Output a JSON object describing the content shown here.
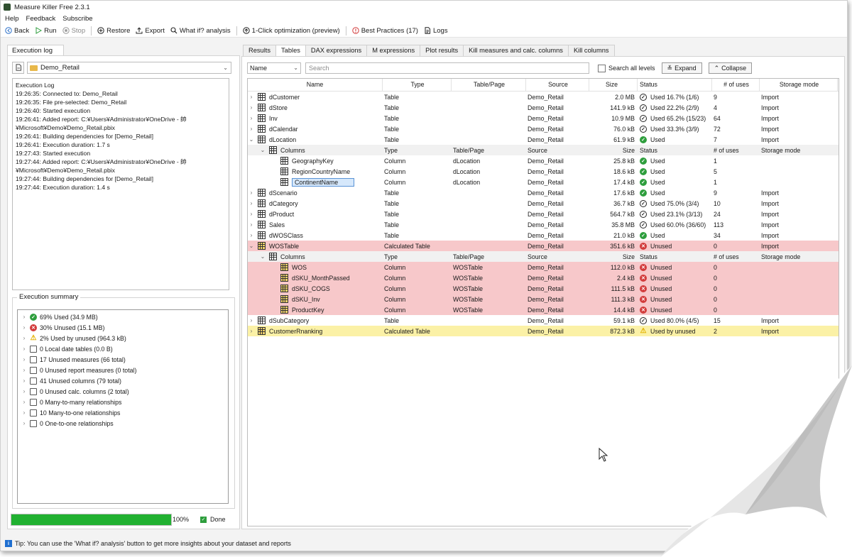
{
  "app": {
    "title": "Measure Killer Free 2.3.1"
  },
  "menu": [
    "Help",
    "Feedback",
    "Subscribe"
  ],
  "toolbar": {
    "back": "Back",
    "run": "Run",
    "stop": "Stop",
    "restore": "Restore",
    "export": "Export",
    "whatif": "What if? analysis",
    "optimize": "1-Click optimization (preview)",
    "best": "Best Practices (17)",
    "logs": "Logs"
  },
  "left": {
    "tab": "Execution log",
    "dataset": "Demo_Retail",
    "log_title": "Execution Log",
    "log_lines": [
      "19:26:35: Connected to: Demo_Retail",
      "19:26:35: File pre-selected: Demo_Retail",
      "19:26:40: Started execution",
      "19:26:41: Added report: C:¥Users¥Administrator¥OneDrive - 帥",
      "¥Microsoft¥Demo¥Demo_Retail.pbix",
      "19:26:41: Building dependencies for [Demo_Retail]",
      "19:26:41: Execution duration: 1.7 s",
      "19:27:43: Started execution",
      "19:27:44: Added report: C:¥Users¥Administrator¥OneDrive - 帥",
      "¥Microsoft¥Demo¥Demo_Retail.pbix",
      "19:27:44: Building dependencies for [Demo_Retail]",
      "19:27:44: Execution duration: 1.4 s"
    ],
    "summary_title": "Execution summary",
    "summary": [
      {
        "icon": "check-green",
        "text": "69% Used (34.9 MB)"
      },
      {
        "icon": "x-red",
        "text": "30% Unused (15.1 MB)"
      },
      {
        "icon": "warning",
        "text": "2% Used by unused (964.3 kB)"
      },
      {
        "icon": "calendar",
        "text": "0 Local date tables (0.0 B)"
      },
      {
        "icon": "calculator",
        "text": "17 Unused measures (66 total)"
      },
      {
        "icon": "calculator",
        "text": "0 Unused report measures (0 total)"
      },
      {
        "icon": "table",
        "text": "41 Unused columns (79 total)"
      },
      {
        "icon": "calc-column",
        "text": "0 Unused calc. columns (2 total)"
      },
      {
        "icon": "relationship",
        "text": "0 Many-to-many relationships"
      },
      {
        "icon": "relationship",
        "text": "10 Many-to-one relationships"
      },
      {
        "icon": "relationship",
        "text": "0 One-to-one relationships"
      }
    ],
    "progress_value": 100,
    "progress_label": "100%",
    "done_label": "Done"
  },
  "tabs": [
    "Results",
    "Tables",
    "DAX expressions",
    "M expressions",
    "Plot results",
    "Kill measures and calc. columns",
    "Kill columns"
  ],
  "active_tab": "Tables",
  "filter": {
    "field": "Name",
    "search_placeholder": "Search",
    "search_all": "Search all levels",
    "expand": "Expand",
    "collapse": "Collapse"
  },
  "columns": [
    "Name",
    "Type",
    "Table/Page",
    "Source",
    "Size",
    "Status",
    "# of uses",
    "Storage mode"
  ],
  "rows": [
    {
      "kind": "table",
      "expand": ">",
      "name": "dCustomer",
      "type": "Table",
      "tp": "",
      "src": "Demo_Retail",
      "size": "2.0 MB",
      "st": "partial",
      "status": "Used 16.7% (1/6)",
      "uses": "9",
      "stor": "Import"
    },
    {
      "kind": "table",
      "expand": ">",
      "name": "dStore",
      "type": "Table",
      "tp": "",
      "src": "Demo_Retail",
      "size": "141.9 kB",
      "st": "partial",
      "status": "Used 22.2% (2/9)",
      "uses": "4",
      "stor": "Import"
    },
    {
      "kind": "table",
      "expand": ">",
      "name": "Inv",
      "type": "Table",
      "tp": "",
      "src": "Demo_Retail",
      "size": "10.9 MB",
      "st": "partial",
      "status": "Used 65.2% (15/23)",
      "uses": "64",
      "stor": "Import"
    },
    {
      "kind": "table",
      "expand": ">",
      "name": "dCalendar",
      "type": "Table",
      "tp": "",
      "src": "Demo_Retail",
      "size": "76.0 kB",
      "st": "partial",
      "status": "Used 33.3% (3/9)",
      "uses": "72",
      "stor": "Import"
    },
    {
      "kind": "table",
      "expand": "v",
      "name": "dLocation",
      "type": "Table",
      "tp": "",
      "src": "Demo_Retail",
      "size": "61.9 kB",
      "st": "used",
      "status": "Used",
      "uses": "7",
      "stor": "Import"
    },
    {
      "kind": "subhdr",
      "name": "Columns",
      "type": "Type",
      "tp": "Table/Page",
      "src": "Source",
      "size": "Size",
      "status": "Status",
      "uses": "# of uses",
      "stor": "Storage mode"
    },
    {
      "kind": "col",
      "name": "GeographyKey",
      "type": "Column",
      "tp": "dLocation",
      "src": "Demo_Retail",
      "size": "25.8 kB",
      "st": "used",
      "status": "Used",
      "uses": "1",
      "stor": ""
    },
    {
      "kind": "col",
      "name": "RegionCountryName",
      "type": "Column",
      "tp": "dLocation",
      "src": "Demo_Retail",
      "size": "18.6 kB",
      "st": "used",
      "status": "Used",
      "uses": "5",
      "stor": ""
    },
    {
      "kind": "col",
      "sel": true,
      "name": "ContinentName",
      "type": "Column",
      "tp": "dLocation",
      "src": "Demo_Retail",
      "size": "17.4 kB",
      "st": "used",
      "status": "Used",
      "uses": "1",
      "stor": ""
    },
    {
      "kind": "table",
      "expand": ">",
      "name": "dScenario",
      "type": "Table",
      "tp": "",
      "src": "Demo_Retail",
      "size": "17.6 kB",
      "st": "used",
      "status": "Used",
      "uses": "9",
      "stor": "Import"
    },
    {
      "kind": "table",
      "expand": ">",
      "name": "dCategory",
      "type": "Table",
      "tp": "",
      "src": "Demo_Retail",
      "size": "36.7 kB",
      "st": "partial",
      "status": "Used 75.0% (3/4)",
      "uses": "10",
      "stor": "Import"
    },
    {
      "kind": "table",
      "expand": ">",
      "name": "dProduct",
      "type": "Table",
      "tp": "",
      "src": "Demo_Retail",
      "size": "564.7 kB",
      "st": "partial",
      "status": "Used 23.1% (3/13)",
      "uses": "24",
      "stor": "Import"
    },
    {
      "kind": "table",
      "expand": ">",
      "name": "Sales",
      "type": "Table",
      "tp": "",
      "src": "Demo_Retail",
      "size": "35.8 MB",
      "st": "partial",
      "status": "Used 60.0% (36/60)",
      "uses": "113",
      "stor": "Import"
    },
    {
      "kind": "table",
      "expand": ">",
      "name": "dWOSClass",
      "type": "Table",
      "tp": "",
      "src": "Demo_Retail",
      "size": "21.0 kB",
      "st": "used",
      "status": "Used",
      "uses": "34",
      "stor": "Import"
    },
    {
      "kind": "calc",
      "row": "red",
      "expand": "v",
      "name": "WOSTable",
      "type": "Calculated Table",
      "tp": "",
      "src": "Demo_Retail",
      "size": "351.6 kB",
      "st": "unused",
      "status": "Unused",
      "uses": "0",
      "stor": "Import"
    },
    {
      "kind": "subhdr",
      "name": "Columns",
      "type": "Type",
      "tp": "Table/Page",
      "src": "Source",
      "size": "Size",
      "status": "Status",
      "uses": "# of uses",
      "stor": "Storage mode"
    },
    {
      "kind": "ccol",
      "row": "red",
      "name": "WOS",
      "type": "Column",
      "tp": "WOSTable",
      "src": "Demo_Retail",
      "size": "112.0 kB",
      "st": "unused",
      "status": "Unused",
      "uses": "0",
      "stor": ""
    },
    {
      "kind": "ccol",
      "row": "red",
      "name": "dSKU_MonthPassed",
      "type": "Column",
      "tp": "WOSTable",
      "src": "Demo_Retail",
      "size": "2.4 kB",
      "st": "unused",
      "status": "Unused",
      "uses": "0",
      "stor": ""
    },
    {
      "kind": "ccol",
      "row": "red",
      "name": "dSKU_COGS",
      "type": "Column",
      "tp": "WOSTable",
      "src": "Demo_Retail",
      "size": "111.5 kB",
      "st": "unused",
      "status": "Unused",
      "uses": "0",
      "stor": ""
    },
    {
      "kind": "ccol",
      "row": "red",
      "name": "dSKU_Inv",
      "type": "Column",
      "tp": "WOSTable",
      "src": "Demo_Retail",
      "size": "111.3 kB",
      "st": "unused",
      "status": "Unused",
      "uses": "0",
      "stor": ""
    },
    {
      "kind": "ccol",
      "row": "red",
      "name": "ProductKey",
      "type": "Column",
      "tp": "WOSTable",
      "src": "Demo_Retail",
      "size": "14.4 kB",
      "st": "unused",
      "status": "Unused",
      "uses": "0",
      "stor": ""
    },
    {
      "kind": "table",
      "expand": ">",
      "name": "dSubCategory",
      "type": "Table",
      "tp": "",
      "src": "Demo_Retail",
      "size": "59.1 kB",
      "st": "partial",
      "status": "Used 80.0% (4/5)",
      "uses": "15",
      "stor": "Import"
    },
    {
      "kind": "calc",
      "row": "yellow",
      "expand": ">",
      "name": "CustomerRnanking",
      "type": "Calculated Table",
      "tp": "",
      "src": "Demo_Retail",
      "size": "872.3 kB",
      "st": "warn",
      "status": "Used by unused",
      "uses": "2",
      "stor": "Import"
    }
  ],
  "tip": "Tip: You can use the 'What if? analysis' button to get more insights about your dataset and reports",
  "colors": {
    "used": "#2e9e3d",
    "unused": "#d23b3b",
    "unused_row": "#f7c8ca",
    "warn_row": "#fbf1a6",
    "progress": "#21b131"
  }
}
